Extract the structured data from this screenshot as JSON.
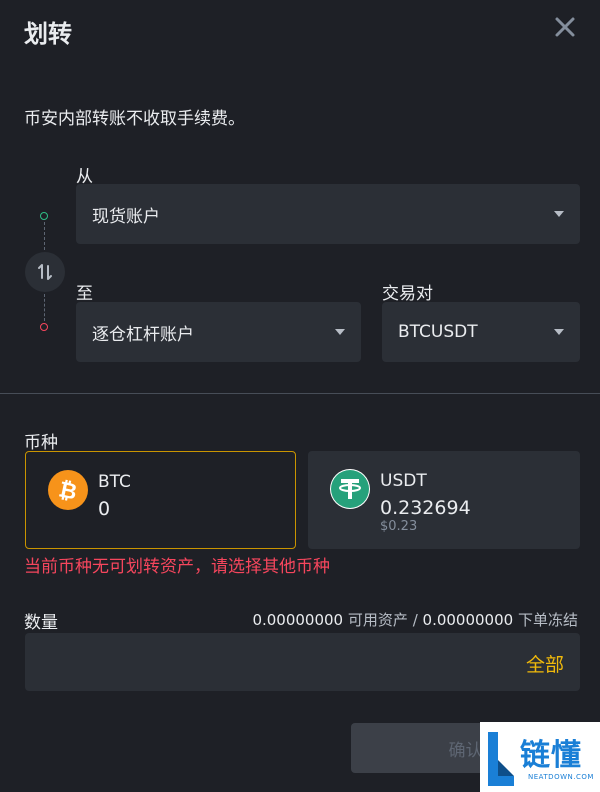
{
  "header": {
    "title": "划转",
    "close_icon": "close-icon"
  },
  "notice": "币安内部转账不收取手续费。",
  "from": {
    "label": "从",
    "value": "现货账户"
  },
  "to": {
    "label": "至",
    "value": "逐仓杠杆账户"
  },
  "pair": {
    "label": "交易对",
    "value": "BTCUSDT"
  },
  "coin": {
    "label": "币种",
    "cards": [
      {
        "icon": "bitcoin-icon",
        "name": "BTC",
        "amount": "0",
        "value": "",
        "selected": true
      },
      {
        "icon": "tether-icon",
        "name": "USDT",
        "amount": "0.232694",
        "value": "$0.23",
        "selected": false
      }
    ],
    "error": "当前币种无可划转资产，请选择其他币种"
  },
  "quantity": {
    "label": "数量",
    "available": "0.00000000",
    "available_label": "可用资产",
    "separator": "/",
    "frozen": "0.00000000",
    "frozen_label": "下单冻结",
    "input_value": "",
    "all_button": "全部"
  },
  "confirm_button": "确认",
  "watermark": {
    "text": "链懂",
    "sub": "NEATDOWN.COM"
  },
  "colors": {
    "background": "#1e2026",
    "field": "#2b2f36",
    "accent": "#f0b90b",
    "error": "#f6465d",
    "success": "#2ebd85",
    "selected_border": "#c99400"
  }
}
